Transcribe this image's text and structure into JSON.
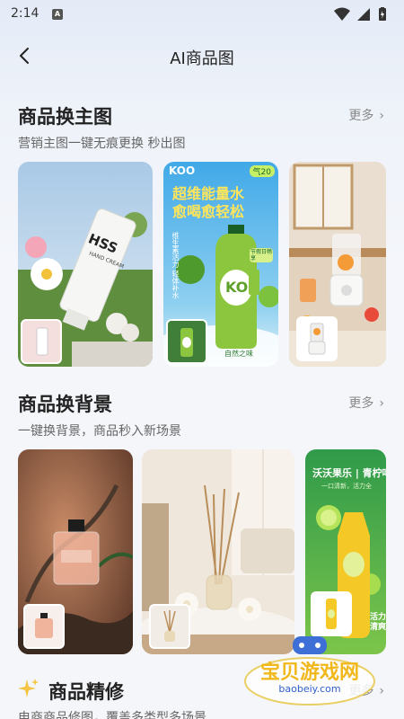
{
  "status": {
    "time": "2:14",
    "app_glyph": "A"
  },
  "nav": {
    "title": "AI商品图"
  },
  "sections": [
    {
      "title": "商品换主图",
      "more": "更多",
      "subtitle": "营销主图一键无痕更换 秒出图"
    },
    {
      "title": "商品换背景",
      "more": "更多",
      "subtitle": "一键换背景，商品秒入新场景"
    },
    {
      "title": "商品精修",
      "more": "更多",
      "subtitle": "电商商品修图，覆盖多类型多场景"
    }
  ],
  "cards": {
    "hss_brand": "HSS",
    "hss_sub": "HAND CREAM",
    "koo_brand": "KOO",
    "koo_badge": "气20",
    "koo_head1": "超维能量水",
    "koo_head2": "愈喝愈轻松",
    "koo_side": "维生素活力 轻体补水",
    "koo_bottle": "KO",
    "koo_tag": "节假日畅享",
    "koo_bottom": "自然之味",
    "juice_head": "沃沃果乐 | 青柠啤",
    "juice_sub": "一口清新，活力全",
    "juice_side": "活力清爽"
  },
  "watermark": {
    "line1": "宝贝游戏网",
    "line2": "baobeiy.com"
  }
}
